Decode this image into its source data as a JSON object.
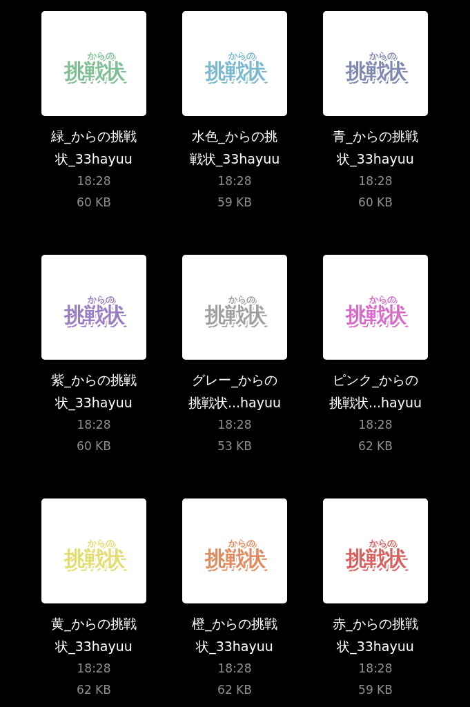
{
  "files": [
    {
      "logo": {
        "kicker": "からの",
        "title": "挑戦状",
        "color": "#7fbf94"
      },
      "name_lines": [
        "緑_からの挑戦",
        "状_33hayuu"
      ],
      "time": "18:28",
      "size": "60 KB"
    },
    {
      "logo": {
        "kicker": "からの",
        "title": "挑戦状",
        "color": "#7ab8d0"
      },
      "name_lines": [
        "水色_からの挑",
        "戦状_33hayuu"
      ],
      "time": "18:28",
      "size": "59 KB"
    },
    {
      "logo": {
        "kicker": "からの",
        "title": "挑戦状",
        "color": "#7f88b0"
      },
      "name_lines": [
        "青_からの挑戦",
        "状_33hayuu"
      ],
      "time": "18:28",
      "size": "60 KB"
    },
    {
      "logo": {
        "kicker": "からの",
        "title": "挑戦状",
        "color": "#9b7dc6"
      },
      "name_lines": [
        "紫_からの挑戦",
        "状_33hayuu"
      ],
      "time": "18:28",
      "size": "60 KB"
    },
    {
      "logo": {
        "kicker": "からの",
        "title": "挑戦状",
        "color": "#a0a0a0"
      },
      "name_lines": [
        "グレー_からの",
        "挑戦状...hayuu"
      ],
      "time": "18:28",
      "size": "53 KB"
    },
    {
      "logo": {
        "kicker": "からの",
        "title": "挑戦状",
        "color": "#d96ac8"
      },
      "name_lines": [
        "ピンク_からの",
        "挑戦状...hayuu"
      ],
      "time": "18:28",
      "size": "62 KB"
    },
    {
      "logo": {
        "kicker": "からの",
        "title": "挑戦状",
        "color": "#e3dc6e"
      },
      "name_lines": [
        "黄_からの挑戦",
        "状_33hayuu"
      ],
      "time": "18:28",
      "size": "62 KB"
    },
    {
      "logo": {
        "kicker": "からの",
        "title": "挑戦状",
        "color": "#e08a5e"
      },
      "name_lines": [
        "橙_からの挑戦",
        "状_33hayuu"
      ],
      "time": "18:28",
      "size": "62 KB"
    },
    {
      "logo": {
        "kicker": "からの",
        "title": "挑戦状",
        "color": "#d9605e"
      },
      "name_lines": [
        "赤_からの挑戦",
        "状_33hayuu"
      ],
      "time": "18:28",
      "size": "59 KB"
    }
  ]
}
